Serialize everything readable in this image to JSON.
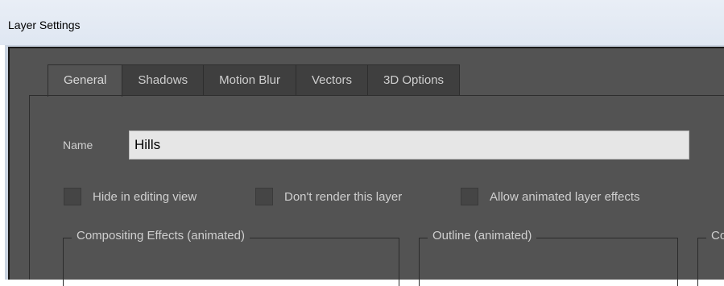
{
  "window": {
    "title": "Layer Settings"
  },
  "tabs": [
    {
      "label": "General",
      "active": true
    },
    {
      "label": "Shadows",
      "active": false
    },
    {
      "label": "Motion Blur",
      "active": false
    },
    {
      "label": "Vectors",
      "active": false
    },
    {
      "label": "3D Options",
      "active": false
    }
  ],
  "general": {
    "name_label": "Name",
    "name_value": "Hills",
    "checkboxes": [
      {
        "label": "Hide in editing view",
        "checked": false
      },
      {
        "label": "Don't render this layer",
        "checked": false
      },
      {
        "label": "Allow animated layer effects",
        "checked": false
      }
    ],
    "groups": [
      {
        "label": "Compositing Effects (animated)"
      },
      {
        "label": "Outline (animated)"
      },
      {
        "label": "Co"
      }
    ]
  },
  "colors": {
    "dialog_bg": "#535353",
    "tab_inactive_bg": "#3f3f3f",
    "input_bg": "#e6e6e6",
    "text": "#cfcfcf"
  }
}
